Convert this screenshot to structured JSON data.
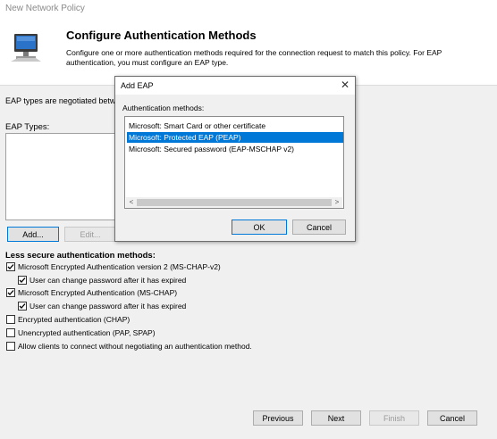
{
  "window": {
    "title": "New Network Policy"
  },
  "header": {
    "title": "Configure Authentication Methods",
    "description": "Configure one or more authentication methods required for the connection request to match this policy. For EAP authentication, you must configure an EAP type."
  },
  "eap": {
    "negotiated_text": "EAP types are negotiated betwe",
    "types_label": "EAP Types:",
    "items": [],
    "add_label": "Add...",
    "edit_label": "Edit..."
  },
  "less_secure": {
    "label": "Less secure authentication methods:",
    "options": [
      {
        "label": "Microsoft Encrypted Authentication version 2 (MS-CHAP-v2)",
        "checked": true
      },
      {
        "label": "User can change password after it has expired",
        "checked": true
      },
      {
        "label": "Microsoft Encrypted Authentication (MS-CHAP)",
        "checked": true
      },
      {
        "label": "User can change password after it has expired",
        "checked": true
      },
      {
        "label": "Encrypted authentication (CHAP)",
        "checked": false
      },
      {
        "label": "Unencrypted authentication (PAP, SPAP)",
        "checked": false
      },
      {
        "label": "Allow clients to connect without negotiating an authentication method.",
        "checked": false
      }
    ]
  },
  "footer": {
    "previous_label": "Previous",
    "next_label": "Next",
    "finish_label": "Finish",
    "cancel_label": "Cancel"
  },
  "dialog": {
    "title": "Add EAP",
    "close_glyph": "✕",
    "auth_label": "Authentication methods:",
    "methods": [
      {
        "label": "Microsoft: Smart Card or other certificate",
        "selected": false
      },
      {
        "label": "Microsoft: Protected EAP (PEAP)",
        "selected": true
      },
      {
        "label": "Microsoft: Secured password (EAP-MSCHAP v2)",
        "selected": false
      }
    ],
    "scroll_left": "<",
    "scroll_right": ">",
    "ok_label": "OK",
    "cancel_label": "Cancel"
  },
  "colors": {
    "selection": "#0078d7",
    "panel": "#f0f0f0"
  },
  "icons": {
    "header": "network-policy-computer-icon"
  }
}
